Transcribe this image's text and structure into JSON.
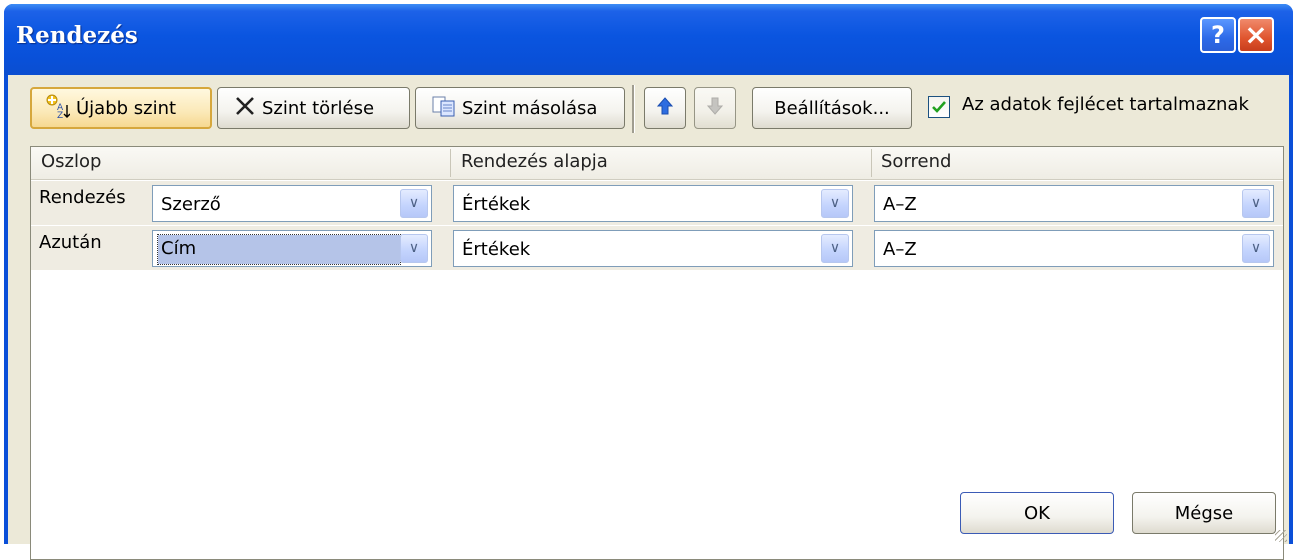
{
  "dialog": {
    "title": "Rendezés",
    "help_label": "?",
    "close_label": "×"
  },
  "toolbar": {
    "add_level_label": "Újabb szint",
    "delete_level_label": "Szint törlése",
    "copy_level_label": "Szint másolása",
    "options_label": "Beállítások...",
    "header_checkbox_label": "Az adatok fejlécet tartalmaznak",
    "header_checkbox_checked": true
  },
  "grid": {
    "columns": [
      "Oszlop",
      "Rendezés alapja",
      "Sorrend"
    ],
    "rows": [
      {
        "label": "Rendezés",
        "column": "Szerző",
        "sort_on": "Értékek",
        "order": "A–Z"
      },
      {
        "label": "Azután",
        "column": "Cím",
        "sort_on": "Értékek",
        "order": "A–Z"
      }
    ]
  },
  "footer": {
    "ok_label": "OK",
    "cancel_label": "Mégse"
  }
}
